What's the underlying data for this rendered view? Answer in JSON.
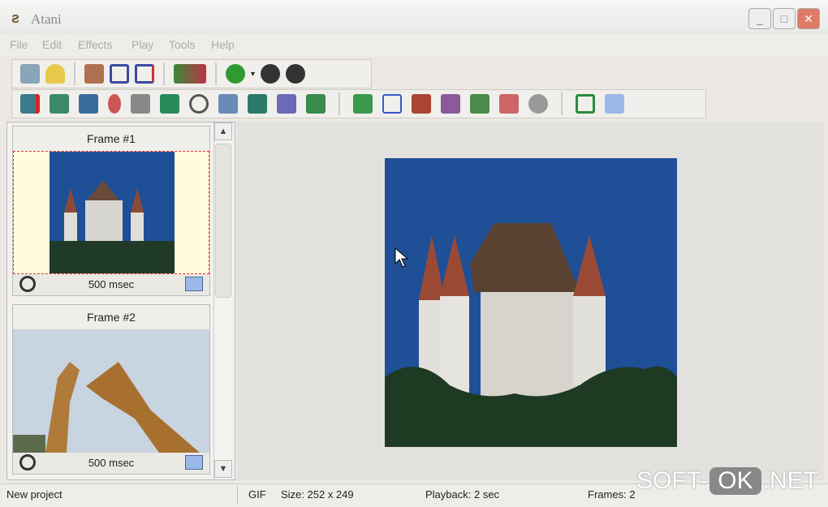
{
  "window": {
    "title": "Atani",
    "minimize": "_",
    "maximize": "□",
    "close": "✕"
  },
  "menu": [
    "File",
    "Edit",
    "Effects",
    "Play",
    "Tools",
    "Help"
  ],
  "frames": [
    {
      "label": "Frame #1",
      "delay": "500 msec"
    },
    {
      "label": "Frame #2",
      "delay": "500 msec"
    }
  ],
  "status": {
    "left": "New project",
    "format": "GIF",
    "size": "Size: 252 x 249",
    "playback": "Playback: 2 sec",
    "frames": "Frames: 2"
  },
  "watermark": {
    "a": "SOFT-",
    "b": "OK",
    ".c": "",
    "c": ".NET"
  },
  "colors": {
    "selection": "#e03030",
    "sky": "#1f4f96"
  }
}
